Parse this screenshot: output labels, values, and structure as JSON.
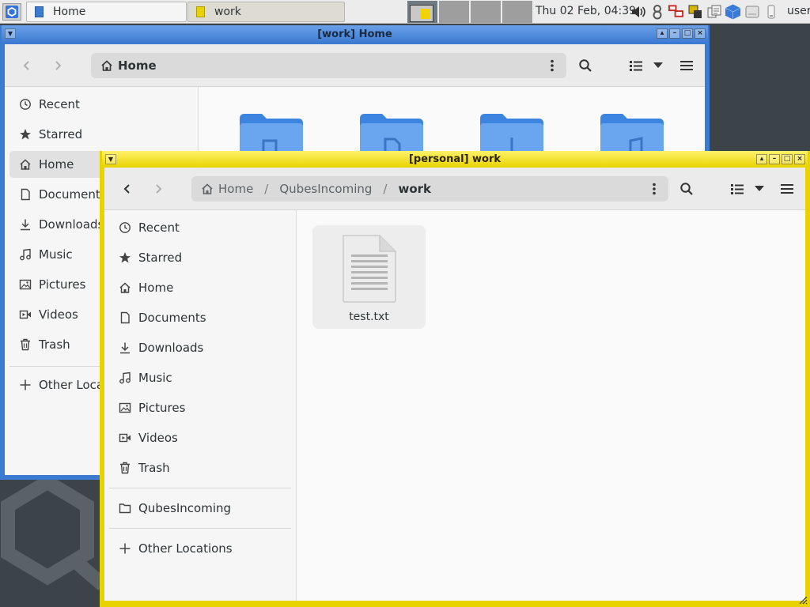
{
  "panel": {
    "tasks": [
      {
        "label": "Home",
        "icon": "file-manager-icon",
        "color": "#3b7bd2"
      },
      {
        "label": "work",
        "icon": "file-manager-icon",
        "color": "#e8d300"
      }
    ],
    "clock": "Thu 02 Feb, 04:39",
    "user": "user",
    "tray_icons": [
      "volume-icon",
      "qube-manager-icon",
      "network-icon",
      "devices-icon",
      "clipboard-icon",
      "qubes-domains-icon",
      "disk-icon",
      "updates-icon"
    ]
  },
  "home_window": {
    "title": "[work] Home",
    "label_color": "#3b7bd2",
    "path": [
      "Home"
    ],
    "sidebar": [
      {
        "label": "Recent",
        "icon": "clock-icon"
      },
      {
        "label": "Starred",
        "icon": "star-icon"
      },
      {
        "label": "Home",
        "icon": "home-icon",
        "active": true
      },
      {
        "label": "Documents",
        "icon": "document-icon"
      },
      {
        "label": "Downloads",
        "icon": "download-icon"
      },
      {
        "label": "Music",
        "icon": "music-icon"
      },
      {
        "label": "Pictures",
        "icon": "picture-icon"
      },
      {
        "label": "Videos",
        "icon": "video-icon"
      },
      {
        "label": "Trash",
        "icon": "trash-icon"
      },
      {
        "label": "Other Locations",
        "icon": "plus-icon"
      }
    ],
    "folders": [
      "desktop-folder",
      "documents-folder",
      "downloads-folder",
      "music-folder"
    ]
  },
  "work_window": {
    "title": "[personal] work",
    "label_color": "#e8d300",
    "path": [
      "Home",
      "QubesIncoming",
      "work"
    ],
    "sidebar": [
      {
        "label": "Recent",
        "icon": "clock-icon"
      },
      {
        "label": "Starred",
        "icon": "star-icon"
      },
      {
        "label": "Home",
        "icon": "home-icon"
      },
      {
        "label": "Documents",
        "icon": "document-icon"
      },
      {
        "label": "Downloads",
        "icon": "download-icon"
      },
      {
        "label": "Music",
        "icon": "music-icon"
      },
      {
        "label": "Pictures",
        "icon": "picture-icon"
      },
      {
        "label": "Videos",
        "icon": "video-icon"
      },
      {
        "label": "Trash",
        "icon": "trash-icon"
      },
      {
        "label": "QubesIncoming",
        "icon": "folder-icon"
      },
      {
        "label": "Other Locations",
        "icon": "plus-icon"
      }
    ],
    "files": [
      {
        "name": "test.txt",
        "icon": "text-file-icon"
      }
    ]
  }
}
